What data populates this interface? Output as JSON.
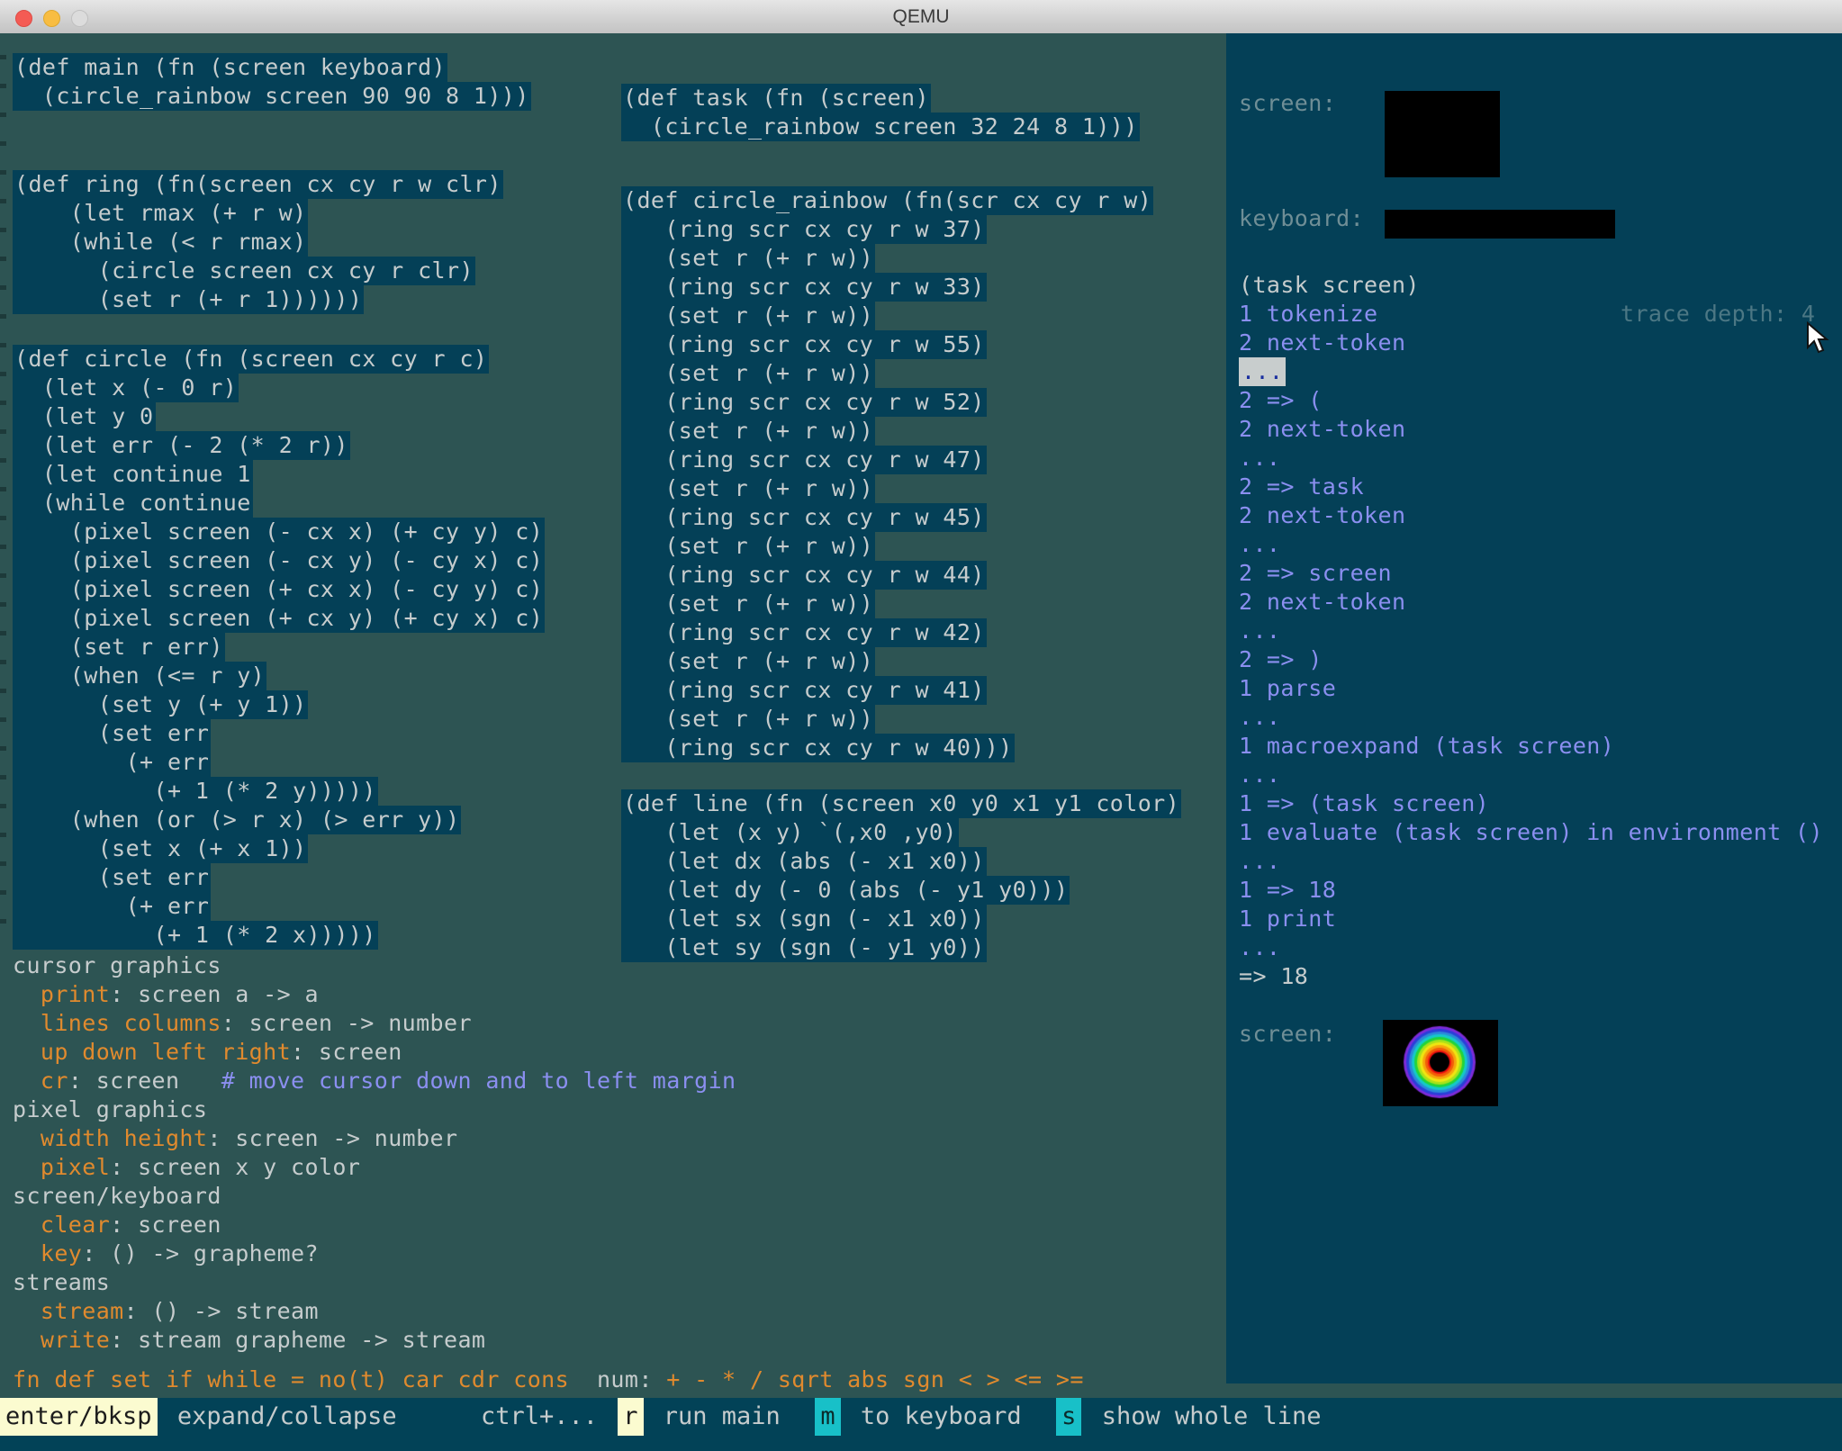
{
  "window": {
    "title": "QEMU",
    "traffic_lights": [
      "close-button",
      "minimize-button",
      "maximize-button"
    ]
  },
  "colors": {
    "background": "#2d5453",
    "code_block": "#044057",
    "right_pane": "#044057",
    "text": "#c6cccd",
    "trace": "#8b8ff0",
    "orange": "#e08a2e",
    "label_gray": "#6f8e96",
    "key_yellow": "#fbfbd0",
    "key_cyan": "#18c0c8",
    "status_bg": "#024257"
  },
  "code_blocks": {
    "main": [
      "(def main (fn (screen keyboard)",
      "  (circle_rainbow screen 90 90 8 1)))"
    ],
    "ring": [
      "(def ring (fn(screen cx cy r w clr)",
      "    (let rmax (+ r w)",
      "    (while (< r rmax)",
      "      (circle screen cx cy r clr)",
      "      (set r (+ r 1))))))"
    ],
    "circle": [
      "(def circle (fn (screen cx cy r c)",
      "  (let x (- 0 r)",
      "  (let y 0",
      "  (let err (- 2 (* 2 r))",
      "  (let continue 1",
      "  (while continue",
      "    (pixel screen (- cx x) (+ cy y) c)",
      "    (pixel screen (- cx y) (- cy x) c)",
      "    (pixel screen (+ cx x) (- cy y) c)",
      "    (pixel screen (+ cx y) (+ cy x) c)",
      "    (set r err)",
      "    (when (<= r y)",
      "      (set y (+ y 1))",
      "      (set err",
      "        (+ err",
      "          (+ 1 (* 2 y)))))",
      "    (when (or (> r x) (> err y))",
      "      (set x (+ x 1))",
      "      (set err",
      "        (+ err",
      "          (+ 1 (* 2 x)))))"
    ],
    "task": [
      "(def task (fn (screen)",
      "  (circle_rainbow screen 32 24 8 1)))"
    ],
    "circle_rainbow": [
      "(def circle_rainbow (fn(scr cx cy r w)",
      "   (ring scr cx cy r w 37)",
      "   (set r (+ r w))",
      "   (ring scr cx cy r w 33)",
      "   (set r (+ r w))",
      "   (ring scr cx cy r w 55)",
      "   (set r (+ r w))",
      "   (ring scr cx cy r w 52)",
      "   (set r (+ r w))",
      "   (ring scr cx cy r w 47)",
      "   (set r (+ r w))",
      "   (ring scr cx cy r w 45)",
      "   (set r (+ r w))",
      "   (ring scr cx cy r w 44)",
      "   (set r (+ r w))",
      "   (ring scr cx cy r w 42)",
      "   (set r (+ r w))",
      "   (ring scr cx cy r w 41)",
      "   (set r (+ r w))",
      "   (ring scr cx cy r w 40)))"
    ],
    "line": [
      "(def line (fn (screen x0 y0 x1 y1 color)",
      "   (let (x y) `(,x0 ,y0)",
      "   (let dx (abs (- x1 x0))",
      "   (let dy (- 0 (abs (- y1 y0)))",
      "   (let sx (sgn (- x1 x0))",
      "   (let sy (sgn (- y1 y0))"
    ]
  },
  "right_panel": {
    "screen_label": "screen:",
    "keyboard_label": "keyboard:",
    "screen2_label": "screen:",
    "trace_depth_label": "trace depth: 4",
    "trace": [
      {
        "text": "(task screen)",
        "color": "white"
      },
      {
        "text": "1 tokenize",
        "color": "blue"
      },
      {
        "text": "2 next-token",
        "color": "blue"
      },
      {
        "text": "...",
        "color": "highlight"
      },
      {
        "text": "2 => (",
        "color": "blue"
      },
      {
        "text": "2 next-token",
        "color": "blue"
      },
      {
        "text": "...",
        "color": "blue"
      },
      {
        "text": "2 => task",
        "color": "blue"
      },
      {
        "text": "2 next-token",
        "color": "blue"
      },
      {
        "text": "...",
        "color": "blue"
      },
      {
        "text": "2 => screen",
        "color": "blue"
      },
      {
        "text": "2 next-token",
        "color": "blue"
      },
      {
        "text": "...",
        "color": "blue"
      },
      {
        "text": "2 => )",
        "color": "blue"
      },
      {
        "text": "1 parse",
        "color": "blue"
      },
      {
        "text": "...",
        "color": "blue"
      },
      {
        "text": "1 macroexpand (task screen)",
        "color": "blue"
      },
      {
        "text": "...",
        "color": "blue"
      },
      {
        "text": "1 => (task screen)",
        "color": "blue"
      },
      {
        "text": "1 evaluate (task screen) in environment ()",
        "color": "blue"
      },
      {
        "text": "...",
        "color": "blue"
      },
      {
        "text": "1 => 18",
        "color": "blue"
      },
      {
        "text": "1 print",
        "color": "blue"
      },
      {
        "text": "...",
        "color": "blue"
      },
      {
        "text": "=> 18",
        "color": "white"
      }
    ]
  },
  "help": [
    {
      "segments": [
        {
          "t": "cursor graphics",
          "c": "gray"
        }
      ]
    },
    {
      "segments": [
        {
          "t": "  ",
          "c": "gray"
        },
        {
          "t": "print",
          "c": "orange"
        },
        {
          "t": ": screen a -> a",
          "c": "gray"
        }
      ]
    },
    {
      "segments": [
        {
          "t": "  ",
          "c": "gray"
        },
        {
          "t": "lines columns",
          "c": "orange"
        },
        {
          "t": ": screen -> number",
          "c": "gray"
        }
      ]
    },
    {
      "segments": [
        {
          "t": "  ",
          "c": "gray"
        },
        {
          "t": "up down left right",
          "c": "orange"
        },
        {
          "t": ": screen",
          "c": "gray"
        }
      ]
    },
    {
      "segments": [
        {
          "t": "  ",
          "c": "gray"
        },
        {
          "t": "cr",
          "c": "orange"
        },
        {
          "t": ": screen   ",
          "c": "gray"
        },
        {
          "t": "# move cursor down and to left margin",
          "c": "blue"
        }
      ]
    },
    {
      "segments": [
        {
          "t": "pixel graphics",
          "c": "gray"
        }
      ]
    },
    {
      "segments": [
        {
          "t": "  ",
          "c": "gray"
        },
        {
          "t": "width height",
          "c": "orange"
        },
        {
          "t": ": screen -> number",
          "c": "gray"
        }
      ]
    },
    {
      "segments": [
        {
          "t": "  ",
          "c": "gray"
        },
        {
          "t": "pixel",
          "c": "orange"
        },
        {
          "t": ": screen x y color",
          "c": "gray"
        }
      ]
    },
    {
      "segments": [
        {
          "t": "screen/keyboard",
          "c": "gray"
        }
      ]
    },
    {
      "segments": [
        {
          "t": "  ",
          "c": "gray"
        },
        {
          "t": "clear",
          "c": "orange"
        },
        {
          "t": ": screen",
          "c": "gray"
        }
      ]
    },
    {
      "segments": [
        {
          "t": "  ",
          "c": "gray"
        },
        {
          "t": "key",
          "c": "orange"
        },
        {
          "t": ": () -> grapheme?",
          "c": "gray"
        }
      ]
    },
    {
      "segments": [
        {
          "t": "streams",
          "c": "gray"
        }
      ]
    },
    {
      "segments": [
        {
          "t": "  ",
          "c": "gray"
        },
        {
          "t": "stream",
          "c": "orange"
        },
        {
          "t": ": () -> stream",
          "c": "gray"
        }
      ]
    },
    {
      "segments": [
        {
          "t": "  ",
          "c": "gray"
        },
        {
          "t": "write",
          "c": "orange"
        },
        {
          "t": ": stream grapheme -> stream",
          "c": "gray"
        }
      ]
    }
  ],
  "keyword_bar": [
    {
      "t": "fn def set if while = no(t) car cdr cons",
      "c": "orange"
    },
    {
      "t": "  ",
      "c": "gray"
    },
    {
      "t": "num:",
      "c": "gray"
    },
    {
      "t": " + - * / sqrt abs sgn < > <= >=",
      "c": "orange"
    }
  ],
  "status_bar": [
    {
      "key": "enter/bksp",
      "desc": "expand/collapse",
      "key_style": "yellow"
    },
    {
      "key": "ctrl+...",
      "desc": "",
      "key_style": "none"
    },
    {
      "key": "r",
      "desc": "run main",
      "key_style": "yellow"
    },
    {
      "key": "m",
      "desc": "to keyboard",
      "key_style": "cyan"
    },
    {
      "key": "s",
      "desc": "show whole line",
      "key_style": "cyan"
    }
  ]
}
